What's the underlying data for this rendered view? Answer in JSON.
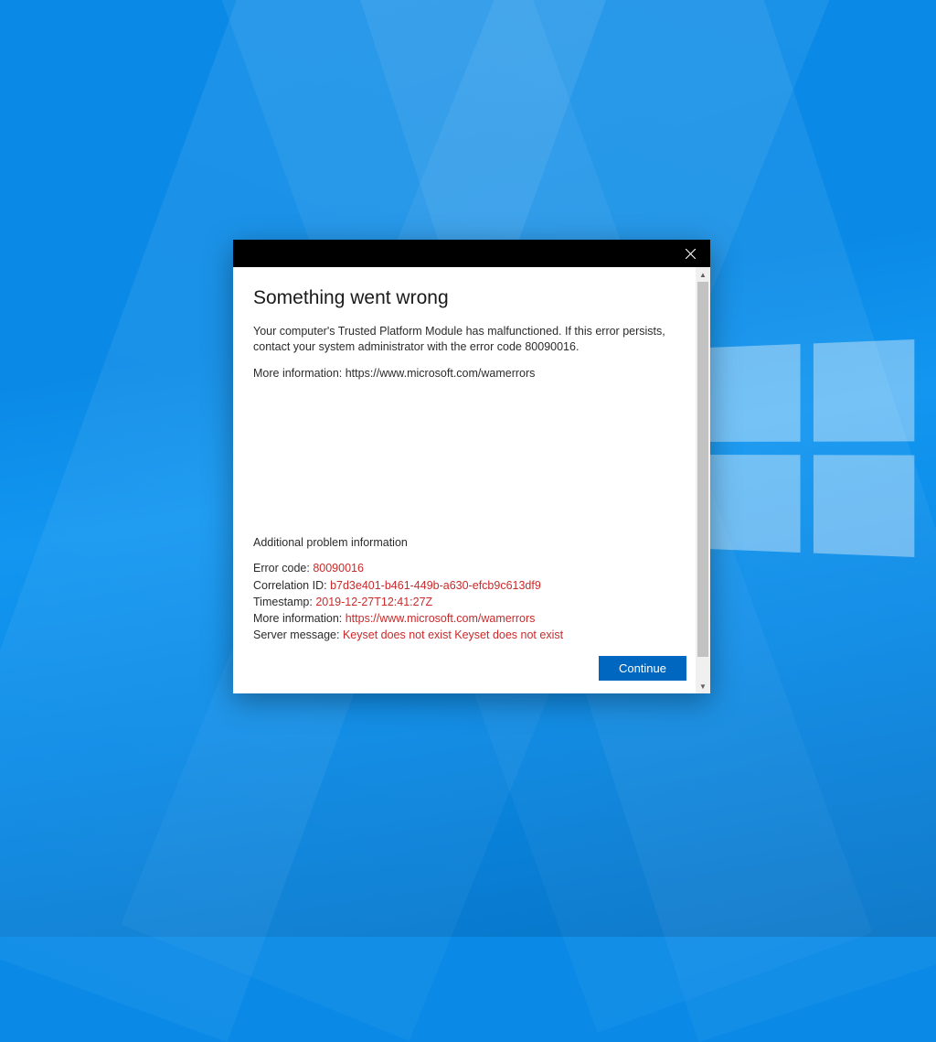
{
  "dialog": {
    "heading": "Something went wrong",
    "body_line1": "Your computer's Trusted Platform Module has malfunctioned. If this error persists, contact your system administrator with the error code 80090016.",
    "body_line2": "More information: https://www.microsoft.com/wamerrors",
    "additional_title": "Additional problem information",
    "details": {
      "error_code_label": "Error code: ",
      "error_code_value": "80090016",
      "correlation_label": "Correlation ID: ",
      "correlation_value": "b7d3e401-b461-449b-a630-efcb9c613df9",
      "timestamp_label": "Timestamp: ",
      "timestamp_value": "2019-12-27T12:41:27Z",
      "moreinfo_label": "More information: ",
      "moreinfo_value": "https://www.microsoft.com/wamerrors",
      "server_label": "Server message: ",
      "server_value": "Keyset does not exist Keyset does not exist"
    },
    "continue_button": "Continue"
  },
  "colors": {
    "error_red": "#c92a2a",
    "primary_blue": "#0067c0"
  }
}
